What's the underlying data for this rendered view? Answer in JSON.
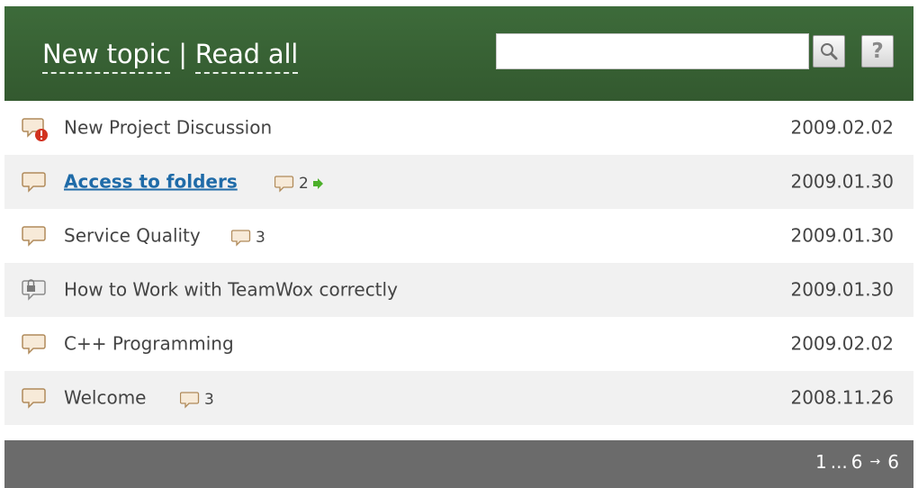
{
  "header": {
    "new_topic": "New topic",
    "separator": "|",
    "read_all": "Read all",
    "search_placeholder": "",
    "search_value": "",
    "help_label": "?"
  },
  "topics": [
    {
      "title": "New Project Discussion",
      "date": "2009.02.02",
      "icon": "comment-alert-icon",
      "count": "",
      "link": false
    },
    {
      "title": "Access to folders",
      "date": "2009.01.30",
      "icon": "comment-icon",
      "count": "2",
      "link": true,
      "has_new_arrow": true
    },
    {
      "title": "Service Quality",
      "date": "2009.01.30",
      "icon": "comment-icon",
      "count": "3",
      "link": false
    },
    {
      "title": "How to Work with TeamWox correctly",
      "date": "2009.01.30",
      "icon": "comment-locked-icon",
      "count": "",
      "link": false
    },
    {
      "title": "C++ Programming",
      "date": "2009.02.02",
      "icon": "comment-icon",
      "count": "",
      "link": false
    },
    {
      "title": "Welcome",
      "date": "2008.11.26",
      "icon": "comment-icon",
      "count": "3",
      "link": false
    }
  ],
  "pager": {
    "first": "1",
    "ellipsis": "...",
    "current": "6",
    "arrow": "→",
    "last": "6"
  },
  "colors": {
    "header_bg": "#3d6b3a",
    "footer_bg": "#6b6b6b",
    "link": "#1f6ba8",
    "row_alt": "#f1f1f1",
    "new_arrow": "#4caf2a"
  }
}
